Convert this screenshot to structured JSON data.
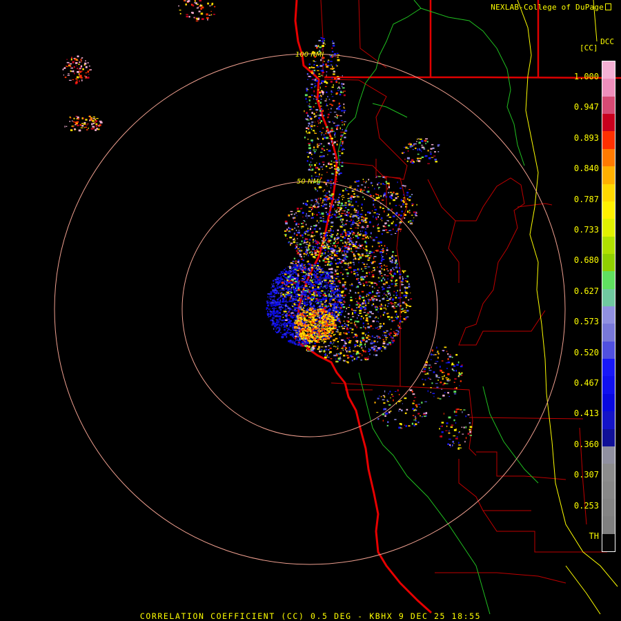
{
  "credit": "NEXLAB-College of DuPage",
  "product_code": "DCC",
  "unit": "[CC]",
  "legend": {
    "ticks": [
      "1.000",
      "0.947",
      "0.893",
      "0.840",
      "0.787",
      "0.733",
      "0.680",
      "0.627",
      "0.573",
      "0.520",
      "0.467",
      "0.413",
      "0.360",
      "0.307",
      "0.253",
      "TH"
    ],
    "colors": [
      "#f4b0d4",
      "#ee8fbc",
      "#d64a74",
      "#c8001e",
      "#ff3000",
      "#ff7a00",
      "#ffb000",
      "#ffd800",
      "#fff000",
      "#e0f000",
      "#b0e000",
      "#90d000",
      "#60e060",
      "#70c8a0",
      "#9090e0",
      "#7878d8",
      "#5050e0",
      "#1818f8",
      "#1010f0",
      "#0808e0",
      "#1414c8",
      "#101098",
      "#9090a0",
      "#8c8c8c",
      "#888888",
      "#848484",
      "#808080",
      "#050505"
    ]
  },
  "rings": [
    "100 NMI",
    "50 NMI"
  ],
  "footer": "CORRELATION COEFFICIENT (CC) 0.5 DEG - KBHX 9 DEC 25 18:55"
}
